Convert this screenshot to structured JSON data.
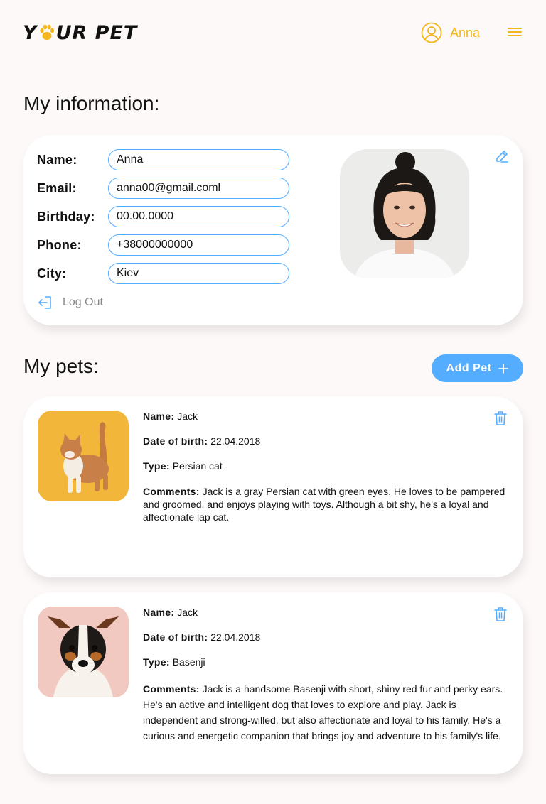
{
  "header": {
    "logo_prefix": "Y",
    "logo_suffix": "UR PET",
    "logo_icon": "paw-icon",
    "user_name": "Anna",
    "user_icon": "user-circle-icon",
    "menu_icon": "burger-menu-icon"
  },
  "info": {
    "title": "My information:",
    "fields": {
      "name": {
        "label": "Name:",
        "value": "Anna"
      },
      "email": {
        "label": "Email:",
        "value": "anna00@gmail.coml"
      },
      "birthday": {
        "label": "Birthday:",
        "value": "00.00.0000"
      },
      "phone": {
        "label": "Phone:",
        "value": "+38000000000"
      },
      "city": {
        "label": "City:",
        "value": "Kiev"
      }
    },
    "logout_label": "Log Out",
    "edit_icon": "pencil-icon"
  },
  "pets": {
    "title": "My pets:",
    "add_label": "Add Pet",
    "keys": {
      "name": "Name:",
      "dob": "Date of birth:",
      "type": "Type:",
      "comments": "Comments:"
    },
    "items": [
      {
        "name": "Jack",
        "dob": "22.04.2018",
        "type": "Persian cat",
        "comments": "Jack is a gray Persian cat with green eyes. He loves to be pampered and groomed, and enjoys playing with toys. Although a bit shy, he's a loyal and affectionate lap cat."
      },
      {
        "name": "Jack",
        "dob": "22.04.2018",
        "type": "Basenji",
        "comments": "Jack is a handsome Basenji with short, shiny red fur and perky ears. He's an active and intelligent dog that loves to explore and play. Jack is independent and strong-willed, but also affectionate and loyal to his family. He's a curious and energetic companion that brings joy and adventure to his family's life."
      }
    ]
  },
  "colors": {
    "accent_yellow": "#F3B61B",
    "accent_blue": "#54ADFF",
    "background": "#FEF9F9"
  }
}
